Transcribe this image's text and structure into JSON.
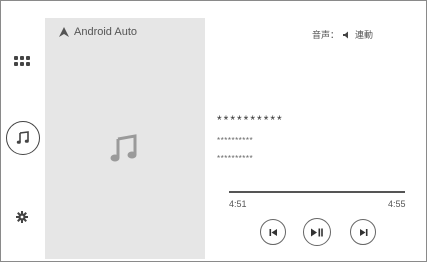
{
  "app": {
    "title": "Android Auto"
  },
  "sidebar": {
    "items": [
      {
        "name": "apps",
        "icon": "grid-icon"
      },
      {
        "name": "media",
        "icon": "music-note-icon",
        "selected": true
      },
      {
        "name": "settings",
        "icon": "gear-icon"
      }
    ]
  },
  "source": {
    "label": "音声：",
    "value": "連動",
    "icon": "speaker-icon"
  },
  "track": {
    "title": "**********",
    "line1": "**********",
    "line2": "**********"
  },
  "playback": {
    "elapsed": "4:51",
    "total": "4:55",
    "progress_fraction": 0.98
  },
  "controls": {
    "prev": "previous-track-icon",
    "play_pause": "play-pause-icon",
    "next": "next-track-icon"
  },
  "colors": {
    "panel": "#e6e6e6",
    "icon": "#444444",
    "background": "#ffffff"
  }
}
